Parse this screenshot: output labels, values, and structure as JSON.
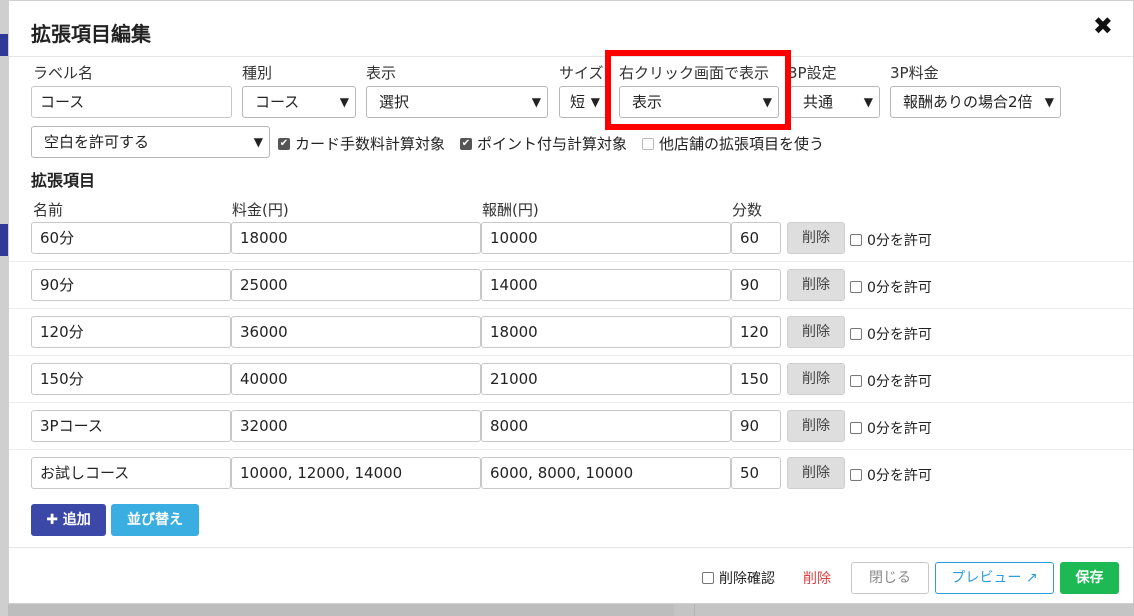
{
  "modal": {
    "title": "拡張項目編集",
    "close_icon": "✖"
  },
  "form": {
    "label_name": {
      "label": "ラベル名",
      "value": "コース"
    },
    "type": {
      "label": "種別",
      "value": "コース"
    },
    "display": {
      "label": "表示",
      "value": "選択"
    },
    "size": {
      "label": "サイズ",
      "value": "短"
    },
    "right_click": {
      "label": "右クリック画面で表示",
      "value": "表示"
    },
    "threep_setting": {
      "label": "3P設定",
      "value": "共通"
    },
    "threep_fee": {
      "label": "3P料金",
      "value": "報酬ありの場合2倍"
    },
    "blank": {
      "value": "空白を許可する"
    },
    "checkboxes": [
      {
        "label": "カード手数料計算対象",
        "checked": true
      },
      {
        "label": "ポイント付与計算対象",
        "checked": true
      },
      {
        "label": "他店舗の拡張項目を使う",
        "checked": false
      }
    ]
  },
  "items": {
    "title": "拡張項目",
    "headers": {
      "name": "名前",
      "price": "料金(円)",
      "reward": "報酬(円)",
      "minutes": "分数"
    },
    "delete_label": "削除",
    "allow_zero_label": "0分を許可",
    "rows": [
      {
        "name": "60分",
        "price": "18000",
        "reward": "10000",
        "minutes": "60"
      },
      {
        "name": "90分",
        "price": "25000",
        "reward": "14000",
        "minutes": "90"
      },
      {
        "name": "120分",
        "price": "36000",
        "reward": "18000",
        "minutes": "120"
      },
      {
        "name": "150分",
        "price": "40000",
        "reward": "21000",
        "minutes": "150"
      },
      {
        "name": "3Pコース",
        "price": "32000",
        "reward": "8000",
        "minutes": "90"
      },
      {
        "name": "お試しコース",
        "price": "10000, 12000, 14000",
        "reward": "6000, 8000, 10000",
        "minutes": "50"
      }
    ]
  },
  "buttons": {
    "add": "追加",
    "sort": "並び替え"
  },
  "footer": {
    "confirm_delete": "削除確認",
    "delete": "削除",
    "close": "閉じる",
    "preview": "プレビュー",
    "save": "保存"
  },
  "colors": {
    "primary": "#3b48a8",
    "info": "#3aaee0",
    "success": "#1db954",
    "danger": "#e04040",
    "highlight": "#ff0000"
  }
}
